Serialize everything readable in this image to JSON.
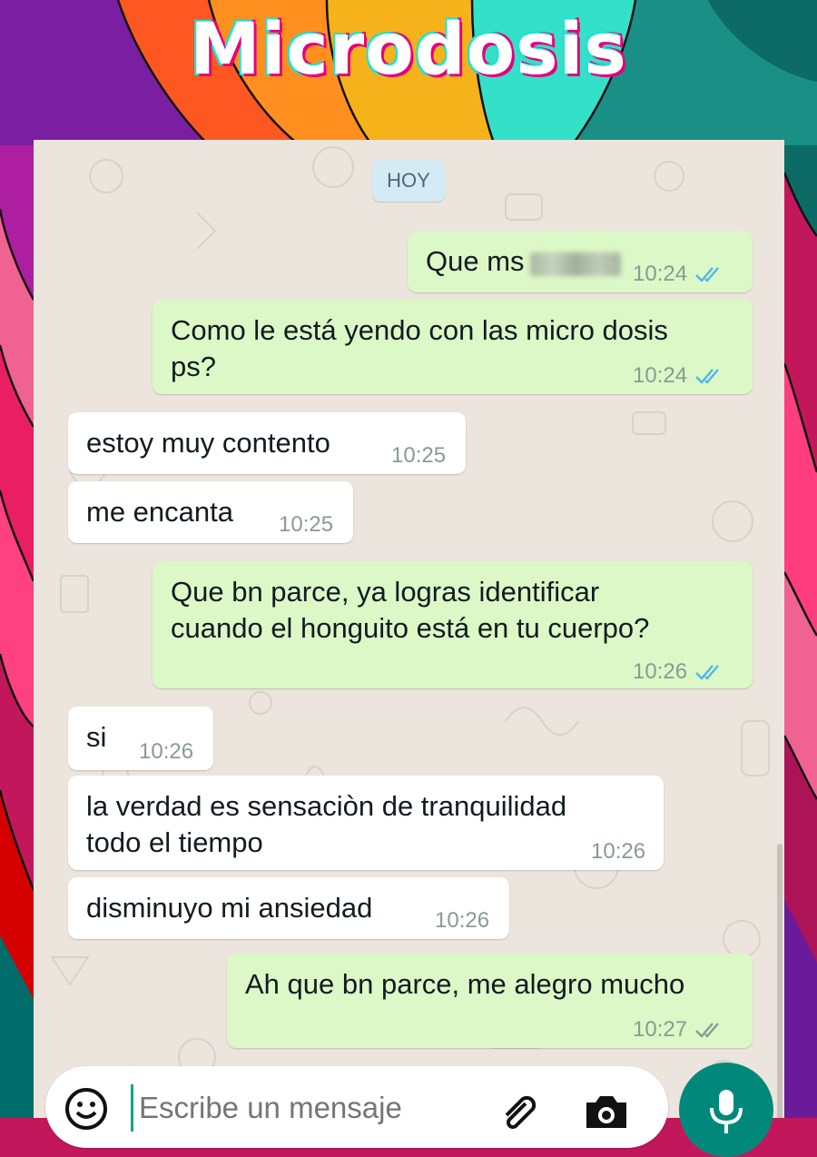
{
  "header": {
    "title": "Microdosis"
  },
  "chat": {
    "date_chip": "HOY",
    "messages": [
      {
        "dir": "out",
        "text": "Que ms",
        "time": "10:24",
        "status": "read",
        "redacted": true
      },
      {
        "dir": "out",
        "text": "Como le está yendo con las micro dosis\nps?",
        "time": "10:24",
        "status": "read"
      },
      {
        "dir": "in",
        "text": "estoy muy contento",
        "time": "10:25"
      },
      {
        "dir": "in",
        "text": "me encanta",
        "time": "10:25"
      },
      {
        "dir": "out",
        "text": "Que bn parce, ya logras identificar\ncuando el honguito está en tu cuerpo?",
        "time": "10:26",
        "status": "read"
      },
      {
        "dir": "in",
        "text": "si",
        "time": "10:26"
      },
      {
        "dir": "in",
        "text": "la verdad es sensaciòn de tranquilidad\ntodo el tiempo",
        "time": "10:26"
      },
      {
        "dir": "in",
        "text": "disminuyo mi ansiedad",
        "time": "10:26"
      },
      {
        "dir": "out",
        "text": "Ah que bn parce, me alegro mucho",
        "time": "10:27",
        "status": "delivered"
      }
    ]
  },
  "composer": {
    "placeholder": "Escribe un mensaje"
  },
  "icons": {
    "emoji": "smiley-icon",
    "attach": "paperclip-icon",
    "camera": "camera-icon",
    "mic": "microphone-icon",
    "read": "double-check-blue-icon",
    "delivered": "double-check-gray-icon"
  },
  "colors": {
    "outgoing_bubble": "#dcf8c6",
    "incoming_bubble": "#ffffff",
    "chat_background": "#ece5dd",
    "read_ticks": "#4fb6ec",
    "delivered_ticks": "#8a9a94",
    "mic_button": "#00897b",
    "date_chip": "#d4eaf4"
  }
}
